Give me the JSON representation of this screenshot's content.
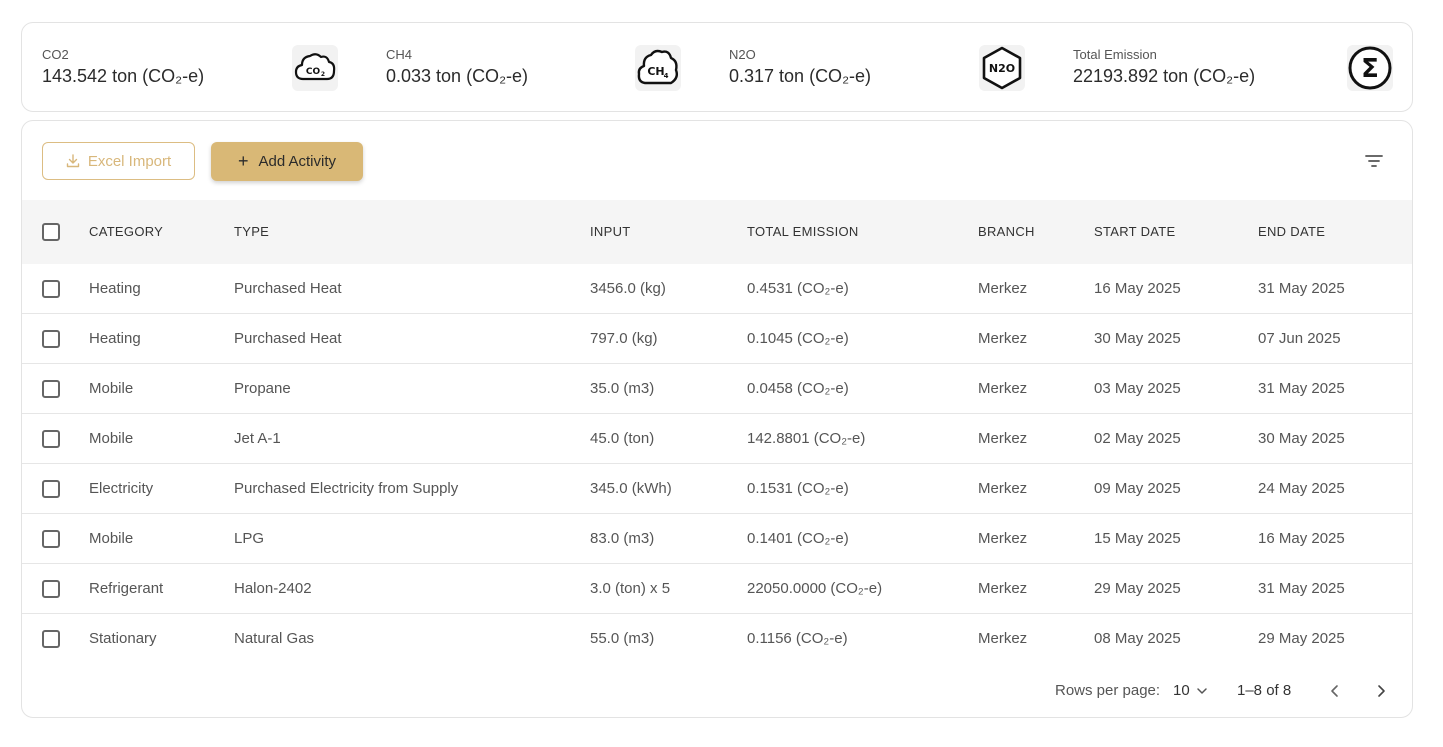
{
  "summary": [
    {
      "label": "CO2",
      "value": "143.542 ton (CO₂-e)",
      "icon": "co2-cloud-icon"
    },
    {
      "label": "CH4",
      "value": "0.033 ton (CO₂-e)",
      "icon": "ch4-cloud-icon"
    },
    {
      "label": "N2O",
      "value": "0.317 ton (CO₂-e)",
      "icon": "n2o-hexagon-icon"
    },
    {
      "label": "Total Emission",
      "value": "22193.892 ton (CO₂-e)",
      "icon": "sigma-icon"
    }
  ],
  "icon_text": {
    "co2": "CO",
    "co2_sub": "2",
    "ch4": "CH",
    "ch4_sub": "4",
    "n2o": "N2O",
    "sigma": "Σ"
  },
  "toolbar": {
    "import_label": "Excel Import",
    "add_label": "Add Activity",
    "add_icon": "+"
  },
  "table": {
    "headers": [
      "CATEGORY",
      "TYPE",
      "INPUT",
      "TOTAL EMISSION",
      "BRANCH",
      "START DATE",
      "END DATE"
    ],
    "rows": [
      {
        "category": "Heating",
        "type": "Purchased Heat",
        "input": "3456.0 (kg)",
        "emission": "0.4531 (CO₂-e)",
        "branch": "Merkez",
        "start": "16 May 2025",
        "end": "31 May 2025"
      },
      {
        "category": "Heating",
        "type": "Purchased Heat",
        "input": "797.0 (kg)",
        "emission": "0.1045 (CO₂-e)",
        "branch": "Merkez",
        "start": "30 May 2025",
        "end": "07 Jun 2025"
      },
      {
        "category": "Mobile",
        "type": "Propane",
        "input": "35.0 (m3)",
        "emission": "0.0458 (CO₂-e)",
        "branch": "Merkez",
        "start": "03 May 2025",
        "end": "31 May 2025"
      },
      {
        "category": "Mobile",
        "type": "Jet A-1",
        "input": "45.0 (ton)",
        "emission": "142.8801 (CO₂-e)",
        "branch": "Merkez",
        "start": "02 May 2025",
        "end": "30 May 2025"
      },
      {
        "category": "Electricity",
        "type": "Purchased Electricity from Supply",
        "input": "345.0 (kWh)",
        "emission": "0.1531 (CO₂-e)",
        "branch": "Merkez",
        "start": "09 May 2025",
        "end": "24 May 2025"
      },
      {
        "category": "Mobile",
        "type": "LPG",
        "input": "83.0 (m3)",
        "emission": "0.1401 (CO₂-e)",
        "branch": "Merkez",
        "start": "15 May 2025",
        "end": "16 May 2025"
      },
      {
        "category": "Refrigerant",
        "type": "Halon-2402",
        "input": "3.0 (ton) x 5",
        "emission": "22050.0000 (CO₂-e)",
        "branch": "Merkez",
        "start": "29 May 2025",
        "end": "31 May 2025"
      },
      {
        "category": "Stationary",
        "type": "Natural Gas",
        "input": "55.0 (m3)",
        "emission": "0.1156 (CO₂-e)",
        "branch": "Merkez",
        "start": "08 May 2025",
        "end": "29 May 2025"
      }
    ]
  },
  "pagination": {
    "rows_per_page_label": "Rows per page:",
    "rows_per_page": "10",
    "range": "1–8 of 8"
  },
  "colors": {
    "accent": "#d9b876",
    "accent_text": "#d8b77b",
    "header_bg": "#f5f5f5",
    "border": "#e3e3e3"
  }
}
